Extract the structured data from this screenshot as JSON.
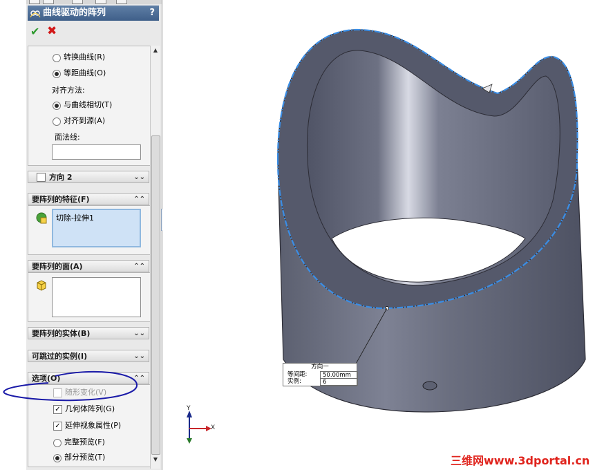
{
  "panel": {
    "title": "曲线驱动的阵列",
    "help": "?",
    "options_top": {
      "radio_transform": "转换曲线(R)",
      "radio_offset": "等距曲线(O)",
      "align_label": "对齐方法:",
      "radio_tangent": "与曲线相切(T)",
      "radio_source": "对齐到源(A)",
      "face_normal_label": "面法线:"
    },
    "direction2": "方向 2",
    "features_header": "要阵列的特征(F)",
    "features_items": [
      "切除-拉伸1"
    ],
    "faces_header": "要阵列的面(A)",
    "bodies_header": "要阵列的实体(B)",
    "skip_header": "可跳过的实例(I)",
    "options_header": "选项(O)",
    "options": {
      "vary_sketch": "随形变化(V)",
      "geometry_pattern": "几何体阵列(G)",
      "propagate_visual": "延伸视象属性(P)",
      "full_preview": "完整预览(F)",
      "partial_preview": "部分预览(T)"
    }
  },
  "callout": {
    "title": "方向一",
    "spacing_label": "等间距:",
    "spacing_value": "50.00mm",
    "count_label": "实例:",
    "count_value": "6"
  },
  "triad": {
    "y": "Y",
    "x": "X"
  },
  "watermark": "三维网www.3dportal.cn",
  "colors": {
    "accent_blue": "#3a8ee6",
    "title_bar": "#4f6f99",
    "annotation_circle": "#1a1aa8",
    "watermark": "#e0241d"
  }
}
